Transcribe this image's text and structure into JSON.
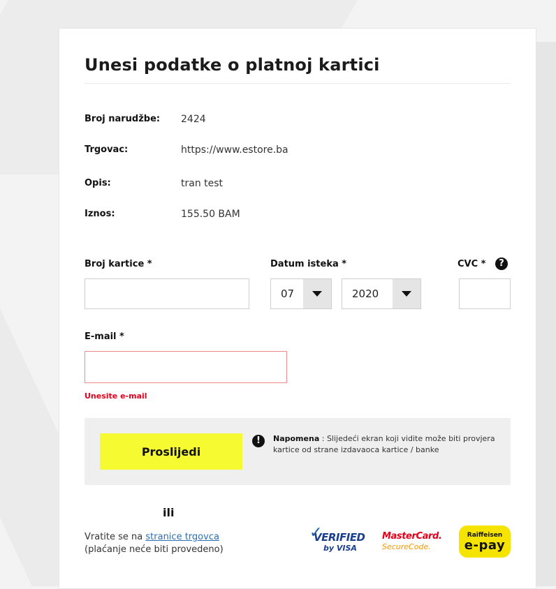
{
  "page": {
    "title": "Unesi podatke o platnoj kartici"
  },
  "order": {
    "number_label": "Broj narudžbe:",
    "number_value": "2424",
    "merchant_label": "Trgovac:",
    "merchant_value": "https://www.estore.ba",
    "description_label": "Opis:",
    "description_value": "tran test",
    "amount_label": "Iznos:",
    "amount_value": "155.50 BAM"
  },
  "form": {
    "card_number_label": "Broj kartice *",
    "card_number_value": "",
    "expiry_label": "Datum isteka *",
    "expiry_month": "07",
    "expiry_year": "2020",
    "cvc_label": "CVC *",
    "cvc_help_icon": "question-icon",
    "cvc_value": "",
    "email_label": "E-mail *",
    "email_value": "",
    "email_error": "Unesite e-mail"
  },
  "actions": {
    "submit_label": "Proslijedi",
    "note_icon": "exclamation-icon",
    "note_strong": "Napomena",
    "note_text": " : Slijedeći ekran koji vidite može biti provjera kartice od strane izdavaoca kartice / banke",
    "or_label": "ili",
    "return_prefix": "Vratite se na ",
    "return_link": "stranice trgovca",
    "return_suffix": "(plaćanje neće biti provedeno)"
  },
  "logos": {
    "visa_line1": "VERIFIED",
    "visa_line2": "by VISA",
    "mc_line1": "MasterCard.",
    "mc_line2": "SecureCode.",
    "rb_line1": "Raiffeisen",
    "rb_line2": "e-pay"
  },
  "colors": {
    "accent_button": "#f5fb30",
    "error": "#e2001a",
    "link": "#2a6fb5"
  }
}
